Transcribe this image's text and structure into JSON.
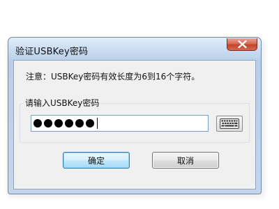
{
  "dialog": {
    "title": "验证USBKey密码",
    "notice": "注意：USBKey密码有效长度为6到16个字符。",
    "input_group_label": "请输入USBKey密码",
    "password_length": 6,
    "ok_label": "确定",
    "cancel_label": "取消",
    "icons": {
      "close": "close-icon",
      "keyboard": "keyboard-icon"
    },
    "colors": {
      "ok_button_border": "#3c7fb1",
      "close_button": "#c2452a",
      "title_bar": "#cddff3"
    }
  }
}
